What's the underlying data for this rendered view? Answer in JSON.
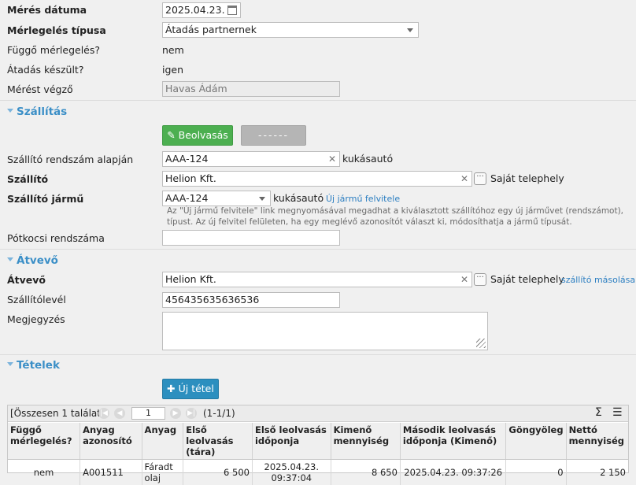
{
  "form": {
    "meres_datuma": {
      "label": "Mérés dátuma",
      "value": "2025.04.23."
    },
    "merlegeles_tipusa": {
      "label": "Mérlegelés típusa",
      "value": "Átadás partnernek"
    },
    "fuggo": {
      "label": "Függő mérlegelés?",
      "value": "nem"
    },
    "atadas": {
      "label": "Átadás készült?",
      "value": "igen"
    },
    "merest_vegzo": {
      "label": "Mérést végző",
      "value": "Havas Ádám"
    }
  },
  "szallitas": {
    "title": "Szállítás",
    "beolvasas_label": "Beolvasás",
    "dash_label": "------",
    "rendszam": {
      "label": "Szállító rendszám alapján",
      "value": "AAA-124",
      "suffix": "kukásautó"
    },
    "szallito": {
      "label": "Szállító",
      "value": "Helion Kft.",
      "suffix": "Saját telephely"
    },
    "jarmu": {
      "label": "Szállító jármű",
      "value": "AAA-124",
      "suffix": "kukásautó",
      "link": "Új jármű felvitele"
    },
    "help": "Az \"Új jármű felvitele\" link megnyomásával megadhat a kiválasztott szállítóhoz egy új járművet (rendszámot), típust. Az új felvitel felületen, ha egy meglévő azonosítót választ ki, módosíthatja a jármű típusát.",
    "potkocsi": {
      "label": "Pótkocsi rendszáma",
      "value": ""
    }
  },
  "atvevo": {
    "title": "Átvevő",
    "atvevo": {
      "label": "Átvevő",
      "value": "Helion Kft.",
      "suffix": "Saját telephely",
      "link": "szállító másolása"
    },
    "szallitolevel": {
      "label": "Szállítólevél",
      "value": "456435635636536"
    },
    "megjegyzes": {
      "label": "Megjegyzés",
      "value": ""
    }
  },
  "tetelek": {
    "title": "Tételek",
    "uj_tetel": "Új tétel",
    "pager": {
      "summary": "[Összesen 1 találat]",
      "page": "1",
      "range": "(1-1/1)"
    },
    "columns": [
      "Függő mérlegelés?",
      "Anyag azonosító",
      "Anyag",
      "Első leolvasás (tára)",
      "Első leolvasás időponja",
      "Kimenő mennyiség",
      "Második leolvasás időponja (Kimenő)",
      "Göngyöleg",
      "Nettó mennyiség"
    ],
    "rows": [
      [
        "nem",
        "A001511",
        "Fáradt olaj",
        "6 500",
        "2025.04.23. 09:37:04",
        "8 650",
        "2025.04.23. 09:37:26",
        "0",
        "2 150"
      ]
    ]
  }
}
